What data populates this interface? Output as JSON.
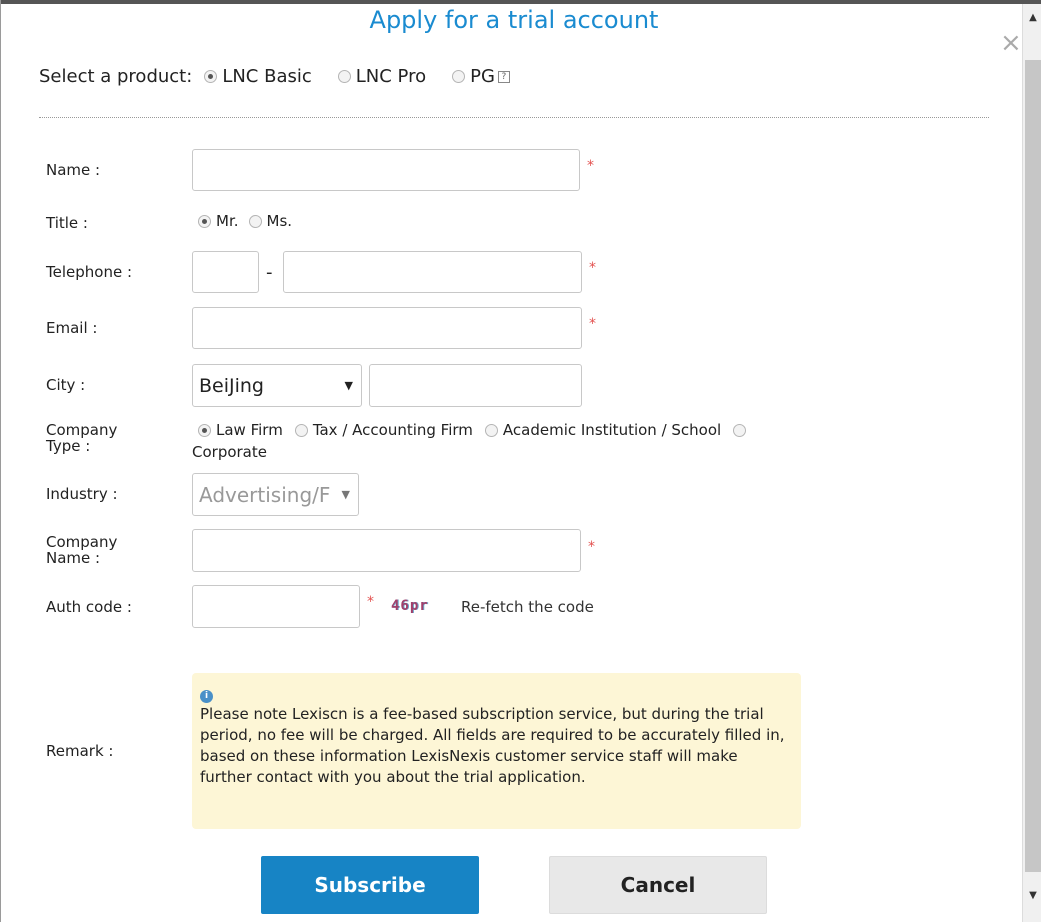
{
  "dialog": {
    "title": "Apply for a trial account",
    "close_glyph": "×"
  },
  "product": {
    "label": "Select a product:",
    "options": [
      {
        "label": "LNC Basic",
        "selected": true
      },
      {
        "label": "LNC Pro",
        "selected": false
      },
      {
        "label": "PG",
        "selected": false
      }
    ],
    "help_glyph": "?"
  },
  "form": {
    "name_label": "Name :",
    "name_value": "",
    "title_label": "Title :",
    "title_options": [
      {
        "label": "Mr.",
        "selected": true
      },
      {
        "label": "Ms.",
        "selected": false
      }
    ],
    "telephone_label": "Telephone :",
    "telephone_dash": "-",
    "telephone_area": "",
    "telephone_number": "",
    "email_label": "Email :",
    "email_value": "",
    "city_label": "City :",
    "city_selected": "BeiJing",
    "city_extra": "",
    "company_type_label": "Company Type :",
    "company_type_options": [
      {
        "label": "Law Firm",
        "selected": true
      },
      {
        "label": "Tax / Accounting Firm",
        "selected": false
      },
      {
        "label": "Academic Institution / School",
        "selected": false
      },
      {
        "label": "Corporate",
        "selected": false
      }
    ],
    "industry_label": "Industry :",
    "industry_selected": "Advertising/F",
    "company_name_label": "Company Name :",
    "company_name_value": "",
    "auth_label": "Auth code :",
    "auth_value": "",
    "captcha_text": "46pr",
    "refetch_label": "Re-fetch the code",
    "required_mark": "*",
    "remark_label": "Remark :",
    "remark_info_glyph": "i",
    "remark_text": "Please note Lexiscn is a fee-based subscription service, but during the trial period, no fee will be charged. All fields are required to be accurately filled in, based on these information LexisNexis customer service staff will make further contact with you about the trial application."
  },
  "buttons": {
    "subscribe": "Subscribe",
    "cancel": "Cancel"
  },
  "scroll": {
    "up_glyph": "▲",
    "down_glyph": "▼"
  },
  "colors": {
    "accent": "#1a8bd0",
    "primary_button": "#1784c5",
    "required": "#e3514f",
    "notice_bg": "#fdf6d6"
  }
}
